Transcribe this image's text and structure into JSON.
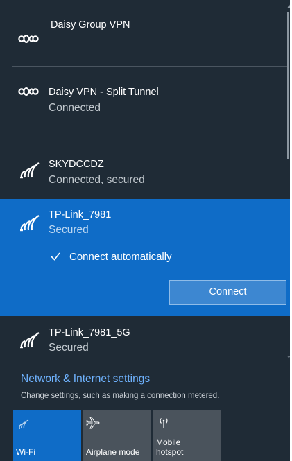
{
  "networks": [
    {
      "name": "Daisy Group VPN",
      "status": "",
      "icon": "vpn-icon"
    },
    {
      "name": "Daisy VPN - Split Tunnel",
      "status": "Connected",
      "icon": "vpn-icon"
    },
    {
      "name": "SKYDCCDZ",
      "status": "Connected, secured",
      "icon": "wifi-icon"
    },
    {
      "name": "TP-Link_7981",
      "status": "Secured",
      "icon": "wifi-icon"
    },
    {
      "name": "TP-Link_7981_5G",
      "status": "Secured",
      "icon": "wifi-icon"
    }
  ],
  "selected_network": {
    "connect_automatically_label": "Connect automatically",
    "connect_automatically_checked": true,
    "connect_button_label": "Connect"
  },
  "settings": {
    "link_label": "Network & Internet settings",
    "description": "Change settings, such as making a connection metered."
  },
  "quick_actions": [
    {
      "label": "Wi-Fi",
      "icon": "wifi-icon",
      "active": true
    },
    {
      "label": "Airplane mode",
      "icon": "airplane-icon",
      "active": false
    },
    {
      "label": "Mobile\nhotspot",
      "icon": "hotspot-icon",
      "active": false
    }
  ],
  "colors": {
    "panel_background": "#1f2b36",
    "accent": "#0f6cc7",
    "link": "#6fb3ff",
    "inactive_tile": "#4a535c"
  }
}
